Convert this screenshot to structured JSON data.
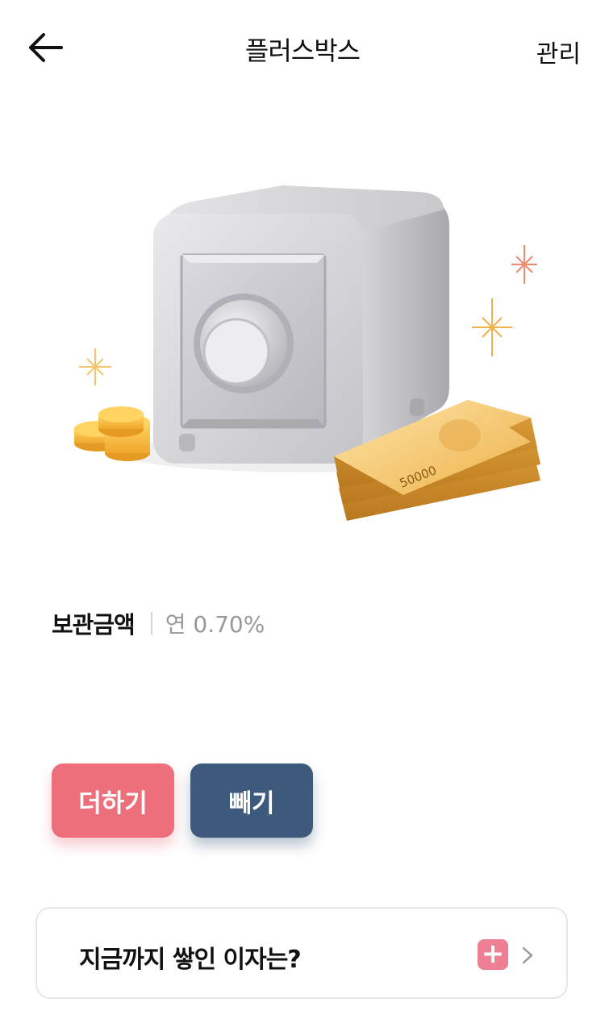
{
  "header": {
    "title": "플러스박스",
    "manage_label": "관리",
    "back_icon": "arrow-left-icon"
  },
  "illustration": {
    "banknote_text": "50000"
  },
  "savings": {
    "amount_label": "보관금액",
    "rate_text": "연 0.70%"
  },
  "actions": {
    "add_label": "더하기",
    "subtract_label": "빼기",
    "add_color": "#ec6f7b",
    "subtract_color": "#3d5a7c"
  },
  "interest_card": {
    "text": "지금까지 쌓인 이자는?",
    "badge_icon": "plus-icon",
    "chevron_icon": "chevron-right-icon"
  }
}
